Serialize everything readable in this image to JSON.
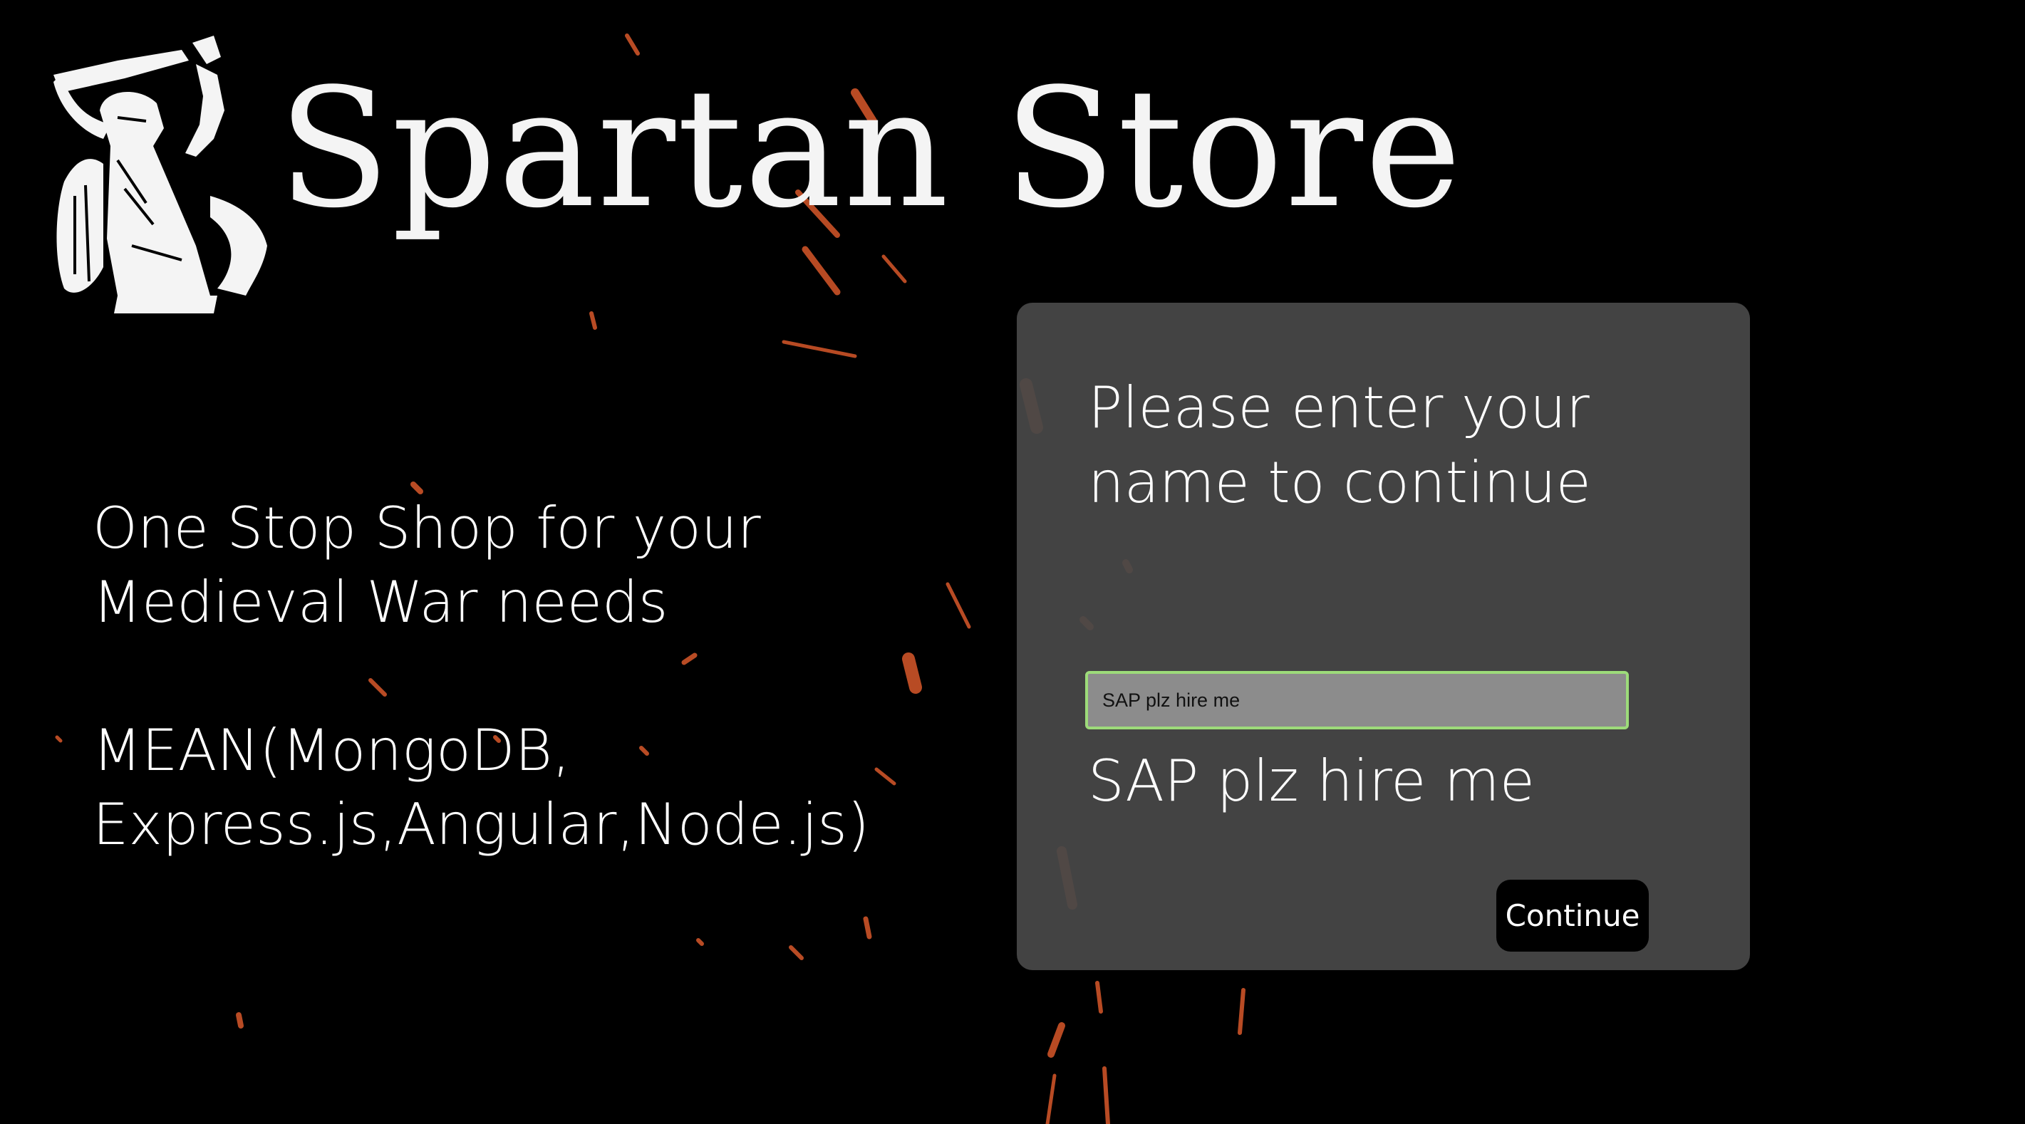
{
  "brand": {
    "title": "Spartan Store",
    "logo_icon": "spartan-warrior-icon"
  },
  "tagline": {
    "line": "One Stop Shop for your Medieval War needs",
    "stack": "MEAN(MongoDB, Express.js,Angular,Node.js)"
  },
  "login": {
    "prompt": "Please enter your name to continue",
    "name_value": "SAP plz hire me",
    "echo": "SAP plz hire me",
    "continue_label": "Continue"
  },
  "colors": {
    "background": "#000000",
    "card": "#484848",
    "input_border": "#9ddb7a",
    "spark": "#e0622a"
  }
}
